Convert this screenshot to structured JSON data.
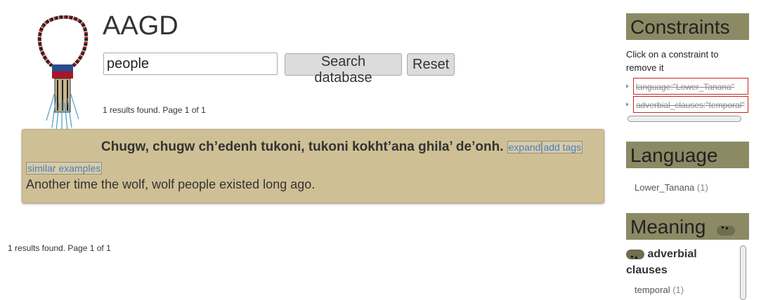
{
  "app": {
    "title": "AAGD"
  },
  "search": {
    "value": "people",
    "search_label": "Search database",
    "reset_label": "Reset"
  },
  "results": {
    "summary_top": "1 results found. Page 1 of 1",
    "summary_bottom": "1 results found. Page 1 of 1"
  },
  "result": {
    "sentence": "Chugw, chugw ch’edenh tukoni, tukoni kokht’ana ghila’ de’onh.",
    "expand_label": "expand",
    "add_tags_label": "add tags",
    "similar_label": "similar examples",
    "translation": "Another time the wolf, wolf people existed long ago."
  },
  "sidebar": {
    "constraints": {
      "title": "Constraints",
      "hint": "Click on a constraint to remove it",
      "items": [
        "language:\"Lower_Tanana\"",
        "adverbial_clauses:\"temporal\""
      ]
    },
    "language": {
      "title": "Language",
      "items": [
        {
          "label": "Lower_Tanana",
          "count": "(1)"
        }
      ]
    },
    "meaning": {
      "title": "Meaning",
      "group": "adverbial clauses",
      "items": [
        {
          "label": "temporal",
          "count": "(1)"
        }
      ]
    }
  },
  "colors": {
    "panel_header": "#8b8a64",
    "card_bg": "#cfbf95",
    "link": "#4a80c0",
    "constraint_border": "#cc2222"
  },
  "icons": [
    "necklace-logo",
    "toggle-pill-icon",
    "bullet-icon"
  ]
}
